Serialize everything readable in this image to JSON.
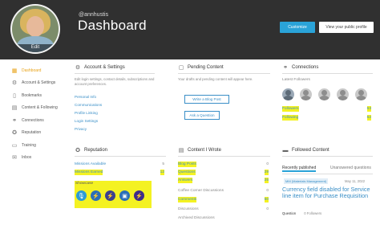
{
  "header": {
    "username": "@annhustis",
    "title": "Dashboard",
    "avatar_edit": "Edit",
    "customize_label": "Customize",
    "profile_label": "View your public profile"
  },
  "sidebar": {
    "items": [
      {
        "label": "Dashboard",
        "icon": "grid-icon"
      },
      {
        "label": "Account & Settings",
        "icon": "gear-icon"
      },
      {
        "label": "Bookmarks",
        "icon": "bookmark-icon"
      },
      {
        "label": "Content & Following",
        "icon": "document-icon"
      },
      {
        "label": "Connections",
        "icon": "connections-icon"
      },
      {
        "label": "Reputation",
        "icon": "reputation-icon"
      },
      {
        "label": "Training",
        "icon": "training-icon"
      },
      {
        "label": "Inbox",
        "icon": "inbox-icon"
      }
    ]
  },
  "account": {
    "title": "Account & Settings",
    "description": "Edit login settings, contact details, subscriptions and account preferences.",
    "links": [
      "Personal Info",
      "Communications",
      "Profile Linking",
      "Login Settings",
      "Privacy"
    ]
  },
  "pending": {
    "title": "Pending Content",
    "description": "Your drafts and pending content will appear here.",
    "blog_button": "Write a Blog Post",
    "question_button": "Ask a Question"
  },
  "connections": {
    "title": "Connections",
    "latest_label": "Latest Followers",
    "followers_label": "Followers",
    "followers_count": "53",
    "following_label": "Following",
    "following_count": "52"
  },
  "reputation": {
    "title": "Reputation",
    "missions_available_label": "Missions Available",
    "missions_available_count": "5",
    "missions_earned_label": "Missions Earned",
    "missions_earned_count": "12",
    "showcase_label": "Showcase"
  },
  "content": {
    "title": "Content I Wrote",
    "rows": [
      {
        "label": "Blog Posts",
        "value": "0"
      },
      {
        "label": "Questions",
        "value": "29"
      },
      {
        "label": "Answers",
        "value": "25"
      },
      {
        "label": "Coffee Corner Discussions",
        "value": "0"
      },
      {
        "label": "Comments",
        "value": "50"
      },
      {
        "label": "Discussions",
        "value": "0"
      },
      {
        "label": "Archived Discussions",
        "value": ""
      }
    ]
  },
  "followed": {
    "title": "Followed Content",
    "tab_recent": "Recently published",
    "tab_unanswered": "Unanswered questions",
    "tag": "MM (Materials Management)",
    "date": "May 11, 2022",
    "question_title": "Currency field disabled for Service line item for Purchase Requisition",
    "type_label": "Question",
    "followers_label": "Followers",
    "followers_count": "0"
  },
  "colors": {
    "header_bg": "#303030",
    "accent": "#2aa3d8",
    "link": "#3a8fc7",
    "active_nav": "#e8a217",
    "highlight": "#f4f222"
  }
}
